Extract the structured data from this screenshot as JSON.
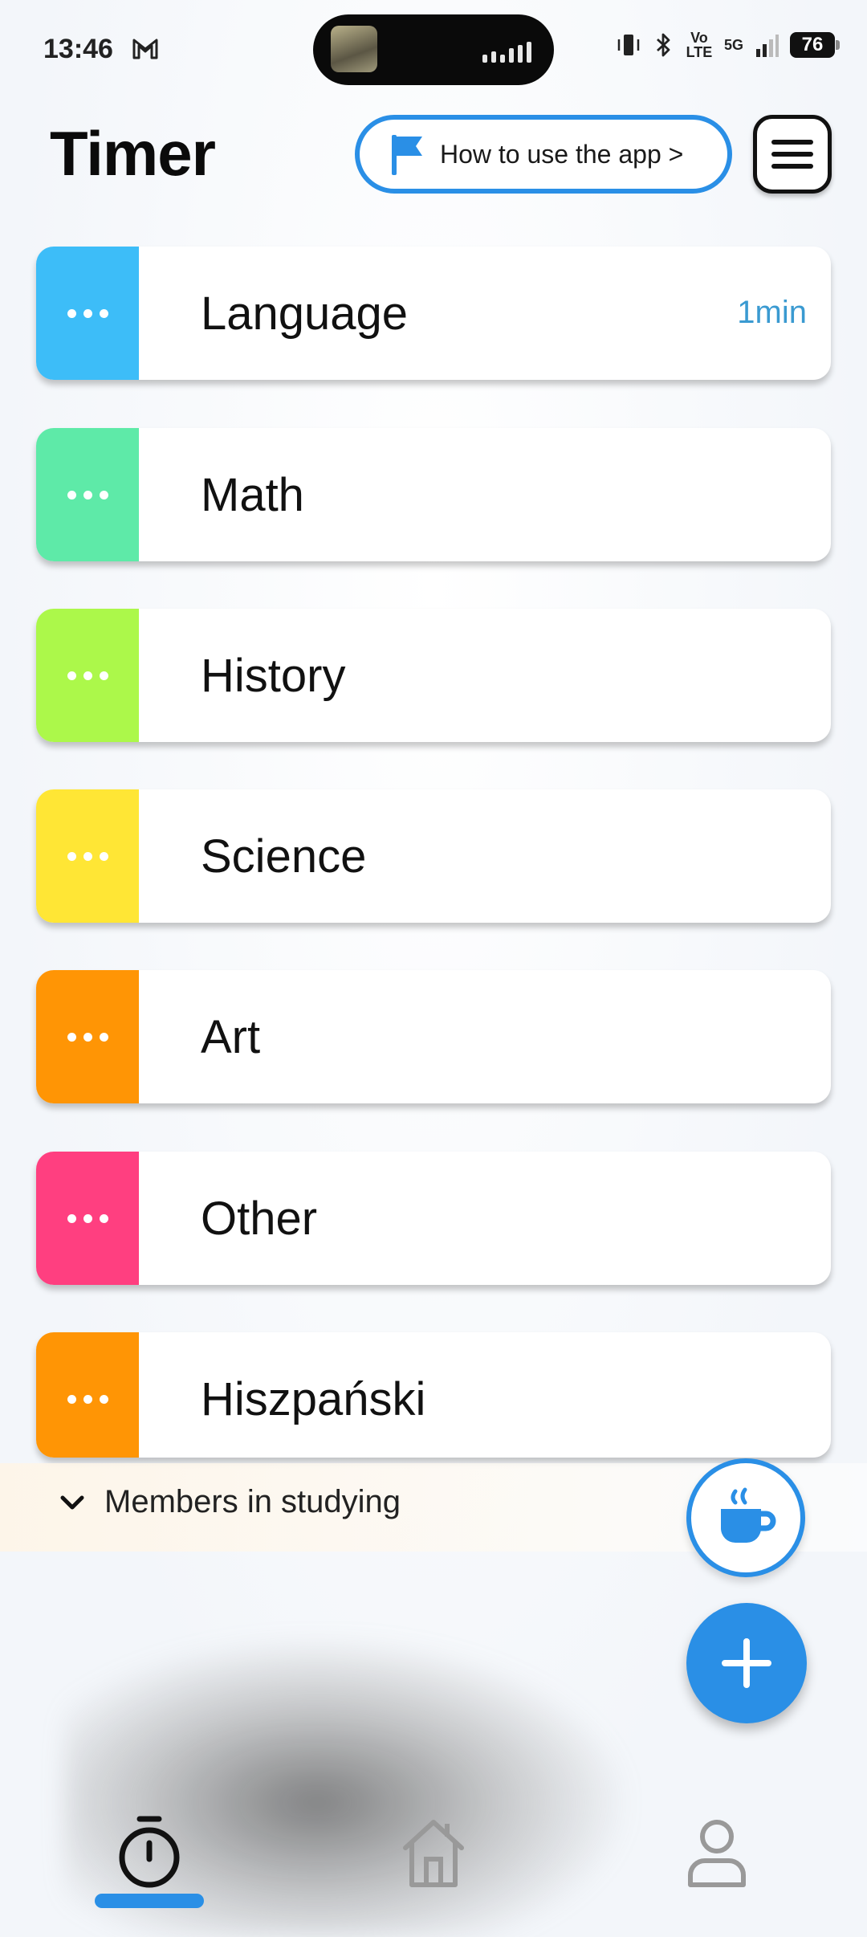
{
  "status_bar": {
    "time": "13:46",
    "battery": "76",
    "network": "5G",
    "volte": "Vo LTE"
  },
  "header": {
    "title": "Timer",
    "howto_label": "How to use the app >"
  },
  "subjects": [
    {
      "name": "Language",
      "time": "1min",
      "color": "#3dbdf8"
    },
    {
      "name": "Math",
      "time": "",
      "color": "#5eeaa8"
    },
    {
      "name": "History",
      "time": "",
      "color": "#acf84a"
    },
    {
      "name": "Science",
      "time": "",
      "color": "#ffe635"
    },
    {
      "name": "Art",
      "time": "",
      "color": "#ff9505"
    },
    {
      "name": "Other",
      "time": "",
      "color": "#ff3f80"
    },
    {
      "name": "Hiszpański",
      "time": "",
      "color": "#ff9505"
    }
  ],
  "members": {
    "label": "Members in studying"
  },
  "colors": {
    "accent": "#2a8fe6",
    "time_text": "#3a9ad1"
  },
  "nav": {
    "items": [
      "timer-icon",
      "home-icon",
      "profile-icon"
    ],
    "active": 0
  }
}
